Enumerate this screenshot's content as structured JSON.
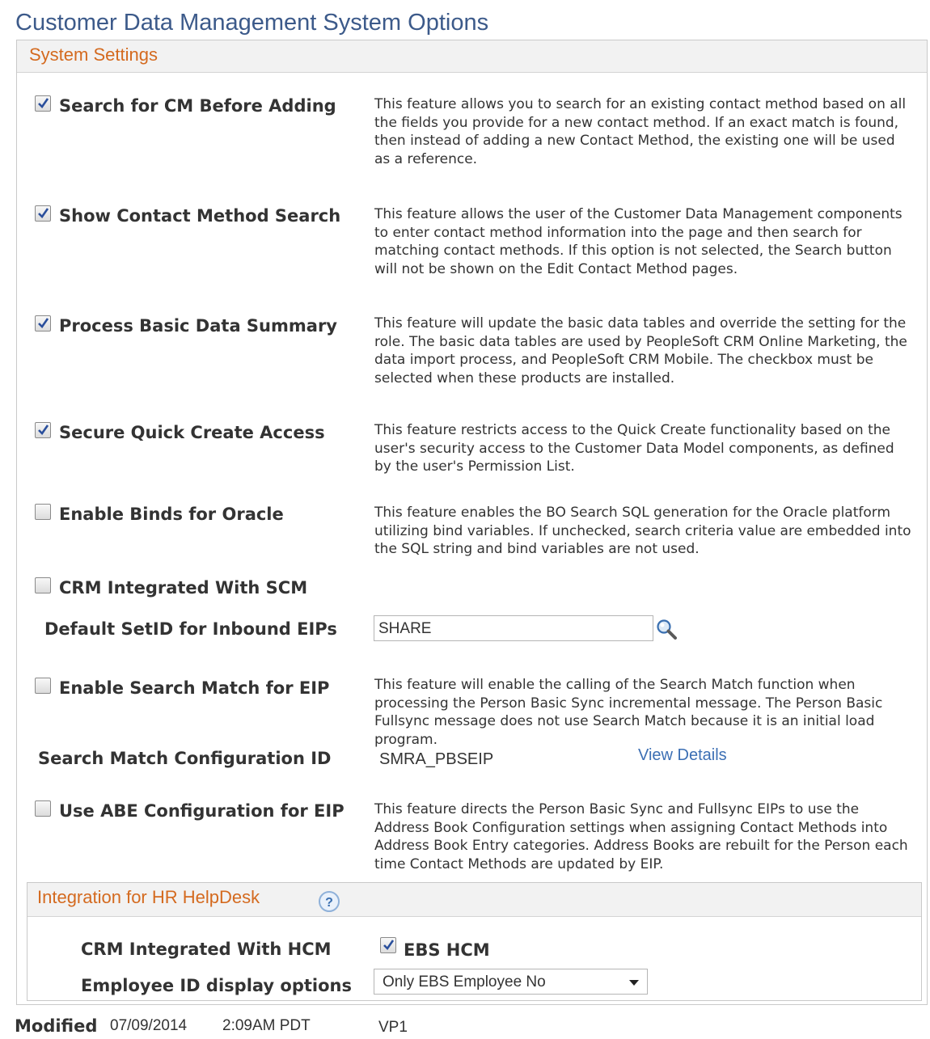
{
  "page": {
    "title": "Customer Data Management System Options"
  },
  "system_settings": {
    "header": "System Settings",
    "options": [
      {
        "label": "Search for CM Before Adding",
        "checked": true,
        "description": "This feature allows you to search for an existing contact method based on all the fields you provide for a new contact method. If an exact match is found, then instead of adding a new Contact Method, the existing one will be used as a reference."
      },
      {
        "label": "Show Contact Method Search",
        "checked": true,
        "description": "This feature allows the user of the Customer Data Management components to enter contact method information into the page and then search for matching contact methods. If this option is not selected, the Search button will not be shown on the Edit Contact Method pages."
      },
      {
        "label": "Process Basic Data Summary",
        "checked": true,
        "description": "This feature will update the basic data tables and override the setting for the role. The basic data tables are used by PeopleSoft CRM Online Marketing, the data import process, and PeopleSoft CRM Mobile. The checkbox must be selected when these products are installed."
      },
      {
        "label": "Secure Quick Create Access",
        "checked": true,
        "description": "This feature restricts access to the Quick Create functionality based on the user's security access to the Customer Data Model components, as defined by the user's Permission List."
      },
      {
        "label": "Enable Binds for Oracle",
        "checked": false,
        "description": "This feature enables the BO Search SQL generation for the Oracle platform utilizing bind variables. If unchecked, search criteria value are embedded into the SQL string and bind variables are not used."
      },
      {
        "label": "CRM Integrated With SCM",
        "checked": false
      }
    ],
    "default_setid": {
      "label": "Default SetID for Inbound EIPs",
      "value": "SHARE",
      "icon": "lookup-icon"
    },
    "search_match": {
      "label": "Enable Search Match for EIP",
      "checked": false,
      "description": "This feature will enable the calling of the Search Match function when processing the Person Basic Sync incremental message. The Person Basic Fullsync message does not use Search Match because it is an initial load program.",
      "config_label": "Search Match Configuration ID",
      "config_value": "SMRA_PBSEIP",
      "details_link": "View Details"
    },
    "abe_config": {
      "label": "Use ABE Configuration for EIP",
      "checked": false,
      "description": "This feature directs the Person Basic Sync and Fullsync EIPs to use the Address Book Configuration settings when assigning Contact Methods into Address Book Entry categories. Address Books are rebuilt for the Person each time Contact Methods are updated by EIP."
    }
  },
  "hr_helpdesk": {
    "header": "Integration for HR HelpDesk",
    "help_icon": "?",
    "hcm_label": "CRM Integrated With HCM",
    "hcm_option": {
      "label": "EBS HCM",
      "checked": true
    },
    "employee_id_label": "Employee ID display options",
    "employee_id_selected": "Only EBS Employee No"
  },
  "footer": {
    "modified_label": "Modified",
    "modified_date": "07/09/2014",
    "modified_time": "2:09AM PDT",
    "modified_by": "VP1"
  },
  "colors": {
    "title": "#3c5a8a",
    "section_title": "#d46a1f",
    "link": "#3c6fb4",
    "check": "#2a4f9c"
  }
}
